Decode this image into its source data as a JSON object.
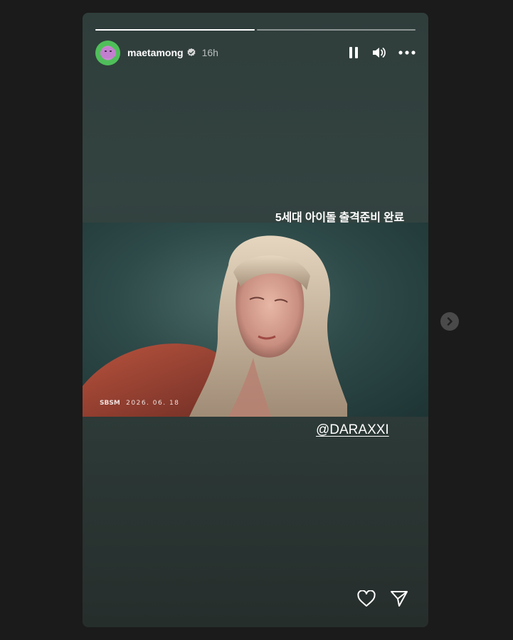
{
  "story": {
    "progress": [
      {
        "filled": 1.0
      },
      {
        "filled": 0.0
      }
    ],
    "user": {
      "username": "maetamong",
      "verified": true,
      "time": "16h"
    },
    "controls": {
      "pause_icon": "pause-icon",
      "volume_icon": "volume-icon",
      "more_icon": "more-icon"
    },
    "caption": "5세대 아이돌 출격준비 완료",
    "photo": {
      "watermark_logo": "SBSM",
      "watermark_date": "2026. 06. 18"
    },
    "mention": "@DARAXXI",
    "actions": {
      "like_icon": "heart-icon",
      "share_icon": "send-icon"
    }
  },
  "navigation": {
    "next_icon": "chevron-right-icon"
  },
  "colors": {
    "page_bg": "#1b1b1b",
    "story_bg": "#334340",
    "text": "#ffffff"
  }
}
